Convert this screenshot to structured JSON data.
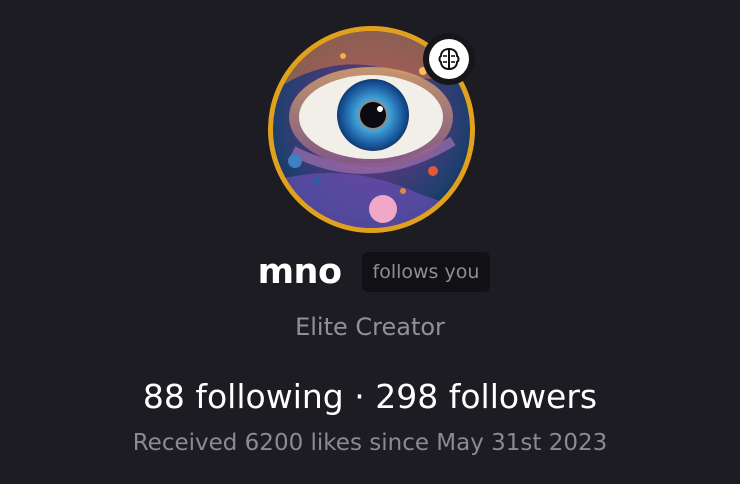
{
  "profile": {
    "username": "mno",
    "follows_you_label": "follows you",
    "role": "Elite Creator",
    "following_count": "88",
    "following_label": "following",
    "separator": "·",
    "followers_count": "298",
    "followers_label": "followers",
    "likes_text": "Received 6200 likes since May 31st 2023"
  },
  "avatar": {
    "icon": "eye-artwork",
    "ring_color": "#e2a11d"
  },
  "badge": {
    "icon": "brain-icon"
  },
  "colors": {
    "background": "#1c1c22",
    "chip_background": "#111115"
  }
}
